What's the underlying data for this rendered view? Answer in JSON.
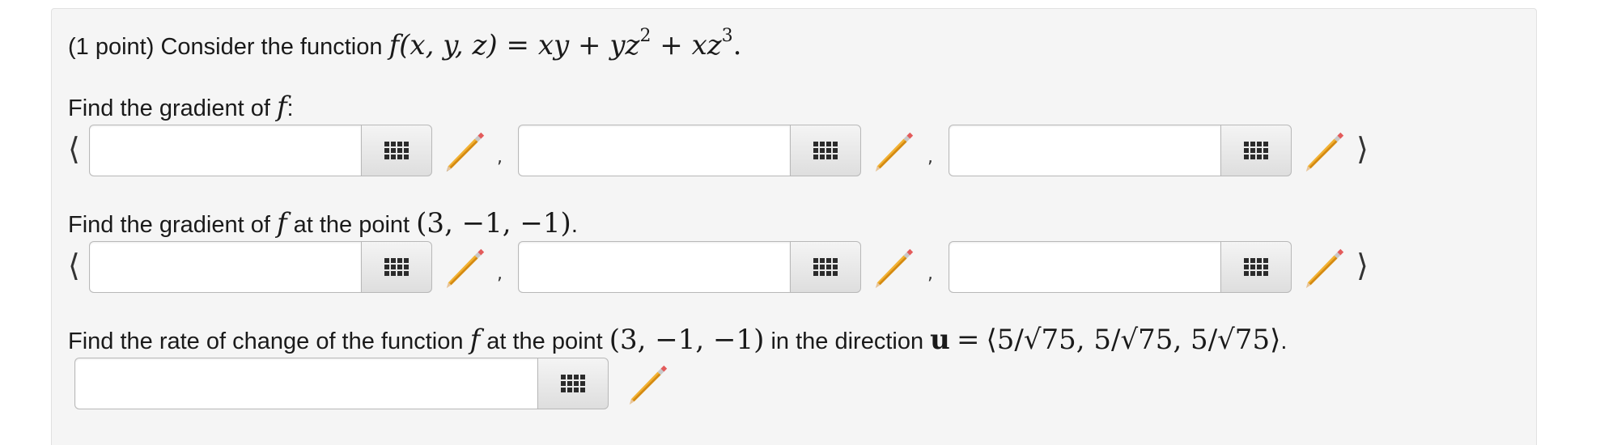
{
  "problem": {
    "points_label": "(1 point) Consider the function",
    "function_lhs": "f(x, y, z)",
    "function_rhs_terms": [
      "xy",
      "yz",
      "xz"
    ],
    "exp_2": "2",
    "exp_3": "3",
    "eq": "=",
    "plus": "+",
    "period": "."
  },
  "part1": {
    "prompt": "Find the gradient of",
    "var": "f",
    "colon": ":"
  },
  "part2": {
    "prompt": "Find the gradient of",
    "var": "f",
    "at_the_point": "at the point",
    "point": "(3, −1, −1)",
    "period": "."
  },
  "part3": {
    "prompt": "Find the rate of change of the function",
    "var": "f",
    "at_the_point": "at the point",
    "point": "(3, −1, −1)",
    "in_direction": "in the direction",
    "u": "u",
    "eq": "=",
    "direction": "⟨5/√75, 5/√75, 5/√75⟩",
    "period": "."
  },
  "brackets": {
    "open": "⟨",
    "close": "⟩",
    "comma": ","
  },
  "inputs": {
    "grad_x": "",
    "grad_y": "",
    "grad_z": "",
    "grad_at_x": "",
    "grad_at_y": "",
    "grad_at_z": "",
    "rate": ""
  },
  "icons": {
    "keypad": "keypad-icon",
    "pencil": "pencil-icon"
  }
}
